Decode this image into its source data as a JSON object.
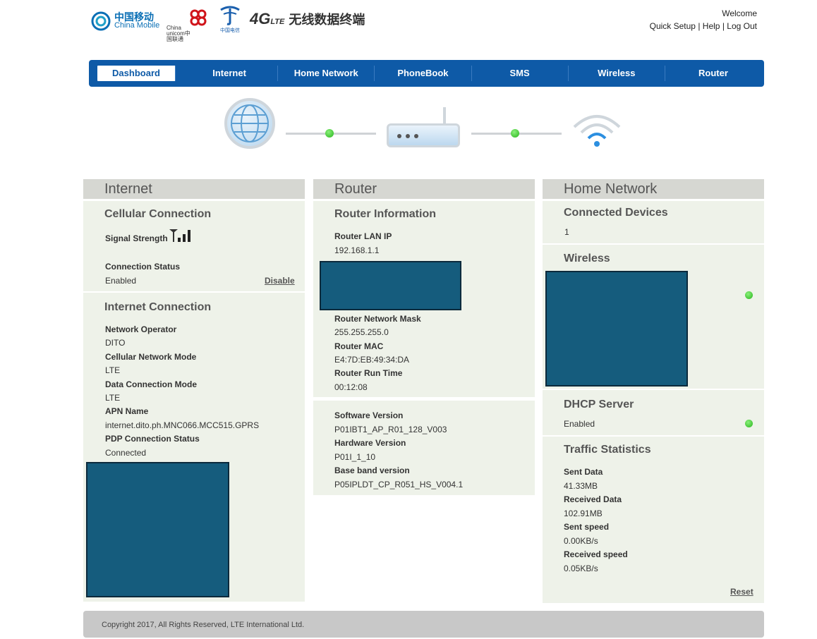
{
  "header": {
    "logo_cm_zh": "中国移动",
    "logo_cm_en": "China Mobile",
    "logo_cu": "China unicom中国联通",
    "logo_ct": "中国电信",
    "brand_4g": "4G",
    "brand_lte": "LTE",
    "brand_zh": "无线数据终端",
    "welcome": "Welcome",
    "links": {
      "quick_setup": "Quick Setup",
      "sep1": "|",
      "help": "Help",
      "sep2": "|",
      "logout": "Log Out"
    }
  },
  "nav": {
    "tabs": [
      "Dashboard",
      "Internet",
      "Home Network",
      "PhoneBook",
      "SMS",
      "Wireless",
      "Router"
    ],
    "active": "Dashboard",
    "accent": "#0e5aa7"
  },
  "internet": {
    "title": "Internet",
    "cellular": {
      "title": "Cellular Connection",
      "signal_label": "Signal Strength",
      "status_label": "Connection Status",
      "status_value": "Enabled",
      "disable": "Disable"
    },
    "connection": {
      "title": "Internet Connection",
      "fields": [
        {
          "label": "Network Operator",
          "value": "DITO"
        },
        {
          "label": "Cellular Network Mode",
          "value": "LTE"
        },
        {
          "label": "Data Connection Mode",
          "value": "LTE"
        },
        {
          "label": "APN Name",
          "value": "internet.dito.ph.MNC066.MCC515.GPRS"
        },
        {
          "label": "PDP Connection Status",
          "value": "Connected"
        }
      ]
    }
  },
  "router": {
    "title": "Router",
    "info_title": "Router Information",
    "fields": [
      {
        "label": "Router LAN IP",
        "value": "192.168.1.1"
      },
      {
        "label": "Router Network Mask",
        "value": "255.255.255.0"
      },
      {
        "label": "Router MAC",
        "value": "E4:7D:EB:49:34:DA"
      },
      {
        "label": "Router Run Time",
        "value": "00:12:08"
      }
    ],
    "versions": [
      {
        "label": "Software Version",
        "value": "P01IBT1_AP_R01_128_V003"
      },
      {
        "label": "Hardware Version",
        "value": "P01I_1_10"
      },
      {
        "label": "Base band version",
        "value": "P05IPLDT_CP_R051_HS_V004.1"
      }
    ]
  },
  "home": {
    "title": "Home Network",
    "connected_title": "Connected Devices",
    "connected_value": "1",
    "wireless_title": "Wireless",
    "dhcp_title": "DHCP Server",
    "dhcp_value": "Enabled",
    "traffic_title": "Traffic Statistics",
    "traffic": [
      {
        "label": "Sent Data",
        "value": "41.33MB"
      },
      {
        "label": "Received Data",
        "value": "102.91MB"
      },
      {
        "label": "Sent speed",
        "value": "0.00KB/s"
      },
      {
        "label": "Received speed",
        "value": "0.05KB/s"
      }
    ],
    "reset": "Reset"
  },
  "footer": {
    "copyright": "Copyright 2017, All Rights Reserved, LTE International Ltd."
  }
}
